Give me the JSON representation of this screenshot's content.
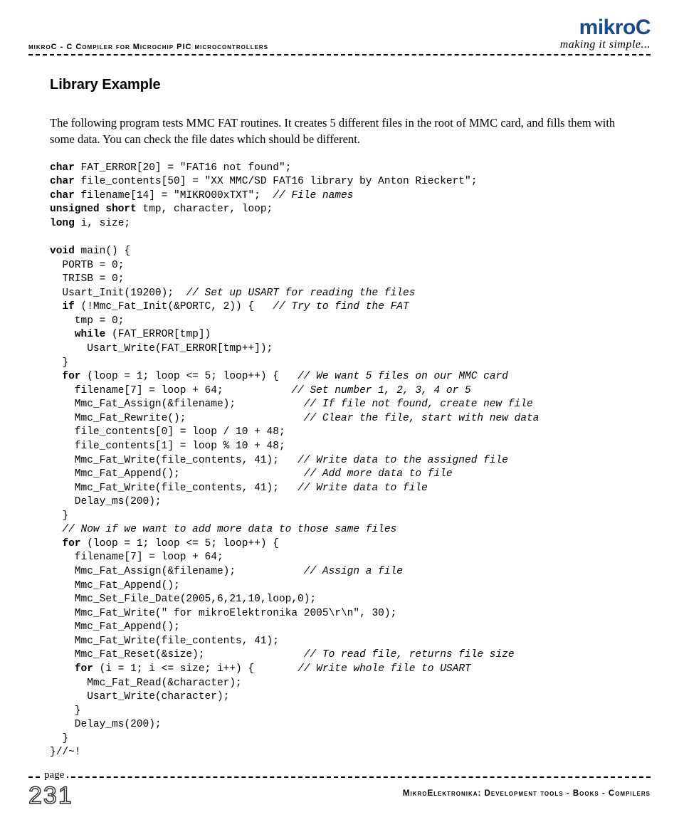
{
  "header": {
    "left": "mikroC - C Compiler for Microchip PIC microcontrollers",
    "logo": "mikroC",
    "tagline": "making it simple..."
  },
  "section_title": "Library Example",
  "body_text": "The following program tests MMC FAT routines. It creates 5 different files in the root of MMC card, and fills them with some data. You can check the file dates which should be different.",
  "code": {
    "l1a": "char",
    "l1b": " FAT_ERROR[20] = \"FAT16 not found\";",
    "l2a": "char",
    "l2b": " file_contents[50] = \"XX MMC/SD FAT16 library by Anton Rieckert\";",
    "l3a": "char",
    "l3b": " filename[14] = \"MIKRO00xTXT\";  ",
    "l3c": "// File names",
    "l4a": "unsigned short",
    "l4b": " tmp, character, loop;",
    "l5a": "long",
    "l5b": " i, size;",
    "l6": "",
    "l7a": "void",
    "l7b": " main() {",
    "l8": "  PORTB = 0;",
    "l9": "  TRISB = 0;",
    "l10a": "  Usart_Init(19200);  ",
    "l10b": "// Set up USART for reading the files",
    "l11a": "  ",
    "l11b": "if",
    "l11c": " (!Mmc_Fat_Init(&PORTC, 2)) {   ",
    "l11d": "// Try to find the FAT",
    "l12": "    tmp = 0;",
    "l13a": "    ",
    "l13b": "while",
    "l13c": " (FAT_ERROR[tmp])",
    "l14": "      Usart_Write(FAT_ERROR[tmp++]);",
    "l15": "  }",
    "l16a": "  ",
    "l16b": "for",
    "l16c": " (loop = 1; loop <= 5; loop++) {   ",
    "l16d": "// We want 5 files on our MMC card",
    "l17a": "    filename[7] = loop + 64;           ",
    "l17b": "// Set number 1, 2, 3, 4 or 5",
    "l18a": "    Mmc_Fat_Assign(&filename);           ",
    "l18b": "// If file not found, create new file",
    "l19a": "    Mmc_Fat_Rewrite();                   ",
    "l19b": "// Clear the file, start with new data",
    "l20": "    file_contents[0] = loop / 10 + 48;",
    "l21": "    file_contents[1] = loop % 10 + 48;",
    "l22a": "    Mmc_Fat_Write(file_contents, 41);   ",
    "l22b": "// Write data to the assigned file",
    "l23a": "    Mmc_Fat_Append();                    ",
    "l23b": "// Add more data to file",
    "l24a": "    Mmc_Fat_Write(file_contents, 41);   ",
    "l24b": "// Write data to file",
    "l25": "    Delay_ms(200);",
    "l26": "  }",
    "l27": "  // Now if we want to add more data to those same files",
    "l28a": "  ",
    "l28b": "for",
    "l28c": " (loop = 1; loop <= 5; loop++) {",
    "l29": "    filename[7] = loop + 64;",
    "l30a": "    Mmc_Fat_Assign(&filename);           ",
    "l30b": "// Assign a file",
    "l31": "    Mmc_Fat_Append();",
    "l32": "    Mmc_Set_File_Date(2005,6,21,10,loop,0);",
    "l33": "    Mmc_Fat_Write(\" for mikroElektronika 2005\\r\\n\", 30);",
    "l34": "    Mmc_Fat_Append();",
    "l35": "    Mmc_Fat_Write(file_contents, 41);",
    "l36a": "    Mmc_Fat_Reset(&size);                ",
    "l36b": "// To read file, returns file size",
    "l37a": "    ",
    "l37b": "for",
    "l37c": " (i = 1; i <= size; i++) {       ",
    "l37d": "// Write whole file to USART",
    "l38": "      Mmc_Fat_Read(&character);",
    "l39": "      Usart_Write(character);",
    "l40": "    }",
    "l41": "    Delay_ms(200);",
    "l42": "  }",
    "l43": "}//~!"
  },
  "footer": {
    "page_label": "page",
    "page_number": "231",
    "text": "MikroElektronika: Development tools - Books - Compilers"
  }
}
